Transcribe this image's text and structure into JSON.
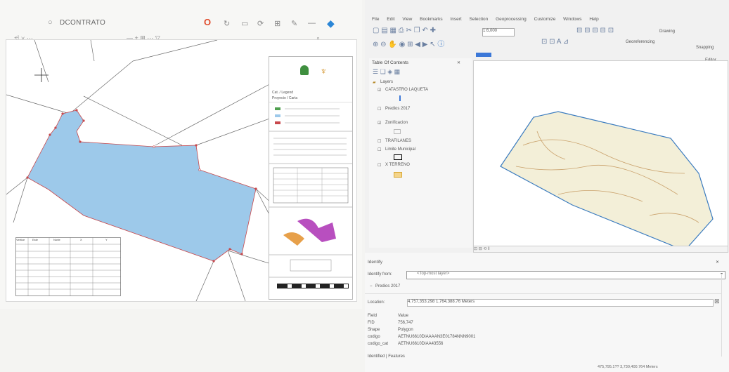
{
  "left_app": {
    "title": "DCONTRATO",
    "map": {
      "coord_table": {
        "headers": [
          "Vertice",
          "Este",
          "Norte",
          "X",
          "Y"
        ]
      },
      "layout_panel": {
        "header_line1": "Cat. / Legend",
        "header_line2": "Proyecto / Carta"
      }
    }
  },
  "right_app": {
    "menu": [
      "File",
      "Edit",
      "View",
      "Bookmarks",
      "Insert",
      "Selection",
      "Geoprocessing",
      "Customize",
      "Windows",
      "Help"
    ],
    "toolbar": {
      "scale": "1:6,000",
      "drawing_label": "Drawing",
      "georeferencing_label": "Georeferencing",
      "snapping_label": "Snapping",
      "editor_label": "Editor"
    },
    "toc": {
      "title": "Table Of Contents",
      "root": "Layers",
      "layers": [
        "CATASTRO LAQUETA",
        "Predios 2017",
        "Zonificacion",
        "TRAFILANES",
        "Limite Municipal",
        "X TERRENO"
      ]
    },
    "identify": {
      "panel_title": "Identify",
      "identify_from_label": "Identify from:",
      "identify_from_value": "<Top-most layer>",
      "tree_item": "Predios 2017",
      "location_label": "Location:",
      "location_value": "4,757,353.298  1,764,388.76 Meters",
      "field_label": "Field",
      "value_label": "Value",
      "rows": [
        {
          "field": "FID",
          "value": "756,747"
        },
        {
          "field": "Shape",
          "value": "Polygon"
        },
        {
          "field": "codigo",
          "value": "AETNU6610DIAAAAN3E01784NNN9001"
        },
        {
          "field": "codigo_cat",
          "value": "AETNU6610DIAA43556"
        }
      ],
      "tabs": "Identified | Features"
    },
    "status": "475,795.1??  3,730,400.764 Meters"
  }
}
